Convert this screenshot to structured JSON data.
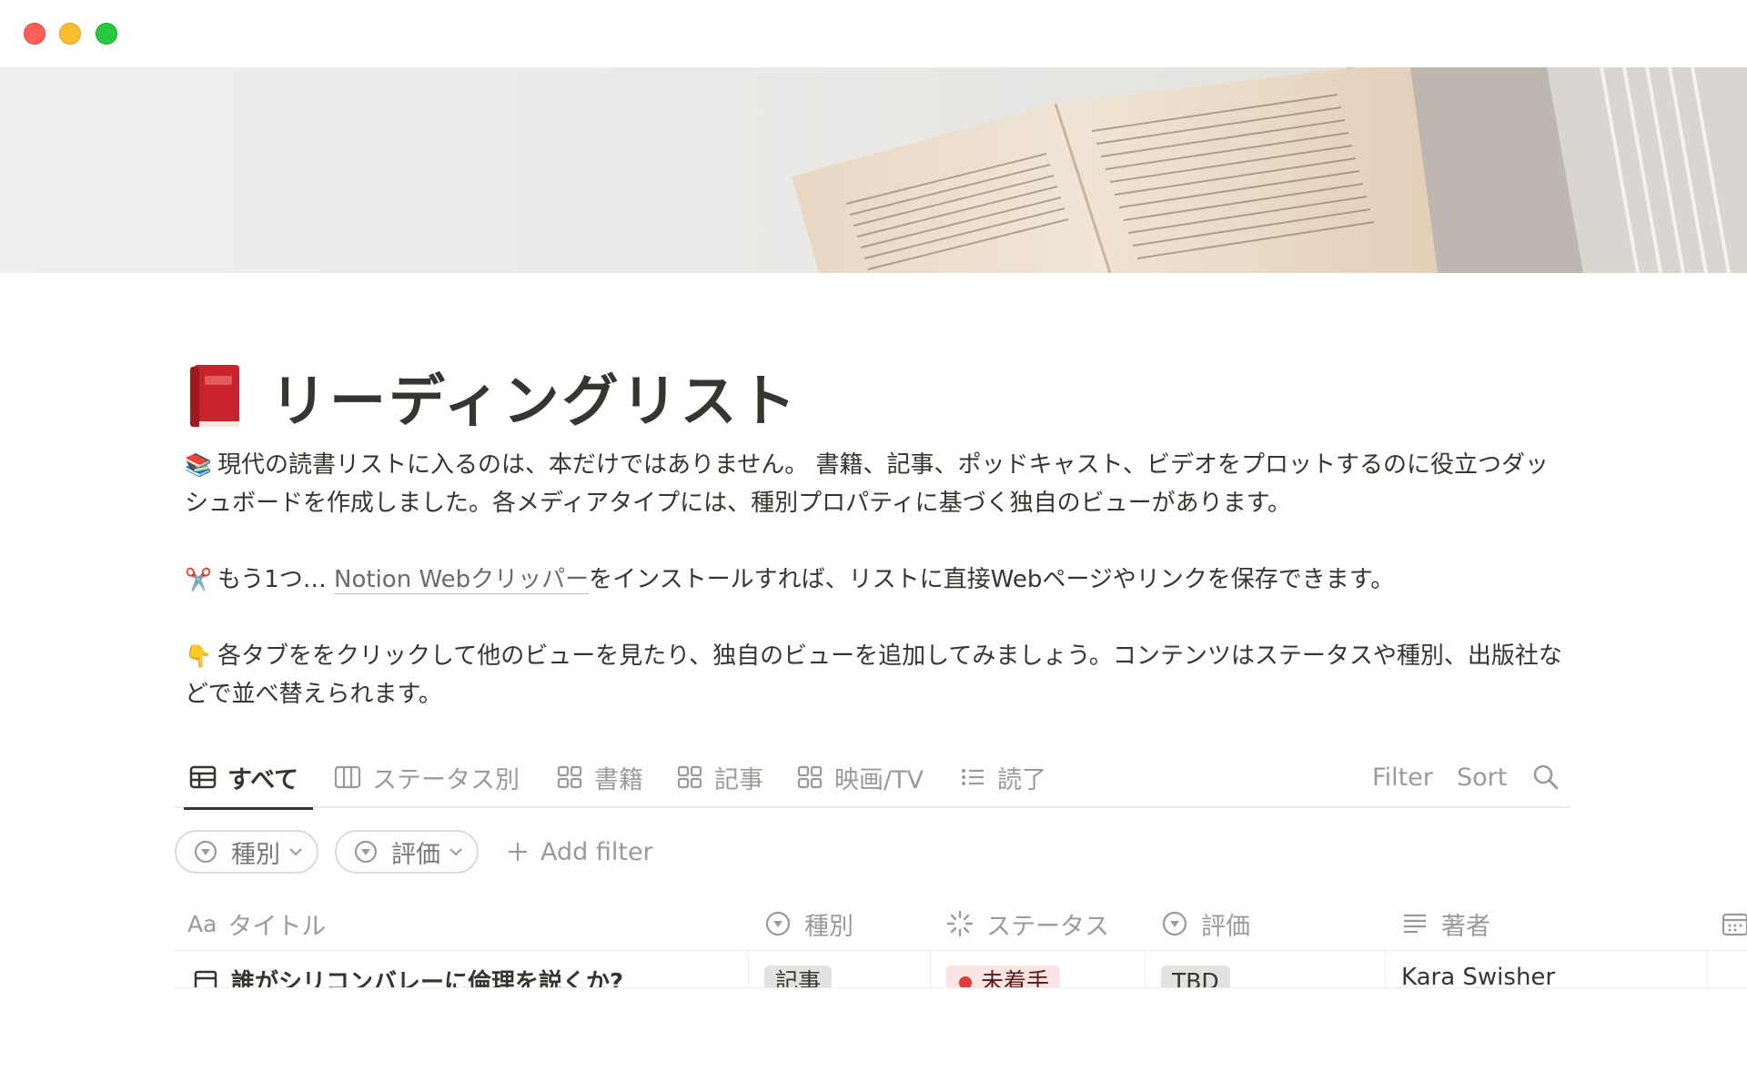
{
  "window": {
    "controls": [
      "close",
      "minimize",
      "zoom"
    ]
  },
  "cover": {
    "description_icon": "open-book-cover-image"
  },
  "page": {
    "icon": "red-book-icon",
    "title": "リーディングリスト",
    "paragraphs": [
      {
        "emoji": "📚",
        "text": "現代の読書リストに入るのは、本だけではありません。 書籍、記事、ポッドキャスト、ビデオをプロットするのに役立つダッシュボードを作成しました。各メディアタイプには、種別プロパティに基づく独自のビューがあります。"
      },
      {
        "emoji": "✂️",
        "prefix": "もう1つ… ",
        "link": "Notion Webクリッパー",
        "suffix": "をインストールすれば、リストに直接Webページやリンクを保存できます。"
      },
      {
        "emoji": "👇",
        "text": "各タブををクリックして他のビューを見たり、独自のビューを追加してみましょう。コンテンツはステータスや種別、出版社などで並べ替えられます。"
      }
    ]
  },
  "tabs": [
    {
      "label": "すべて",
      "icon": "table-icon",
      "active": true
    },
    {
      "label": "ステータス別",
      "icon": "board-icon",
      "active": false
    },
    {
      "label": "書籍",
      "icon": "gallery-icon",
      "active": false
    },
    {
      "label": "記事",
      "icon": "gallery-icon",
      "active": false
    },
    {
      "label": "映画/TV",
      "icon": "gallery-icon",
      "active": false
    },
    {
      "label": "読了",
      "icon": "list-icon",
      "active": false
    }
  ],
  "toolbar": {
    "filter_label": "Filter",
    "sort_label": "Sort",
    "search_icon": "search-icon"
  },
  "filters": [
    {
      "label": "種別",
      "icon": "select-property-icon"
    },
    {
      "label": "評価",
      "icon": "select-property-icon"
    }
  ],
  "add_filter_label": "Add filter",
  "table": {
    "columns": [
      {
        "label": "タイトル",
        "icon": "Aa"
      },
      {
        "label": "種別",
        "icon": "select-property-icon"
      },
      {
        "label": "ステータス",
        "icon": "status-property-icon"
      },
      {
        "label": "評価",
        "icon": "select-property-icon"
      },
      {
        "label": "著者",
        "icon": "text-property-icon"
      }
    ],
    "rows": [
      {
        "title": "誰がシリコンバレーに倫理を説くか?",
        "type": "記事",
        "status": "未着手",
        "rating": "TBD",
        "author": "Kara Swisher"
      }
    ]
  },
  "colors": {
    "text": "#37352f",
    "muted": "#9b9a97",
    "tag_gray": "#e3e2e0",
    "status_red_bg": "#fbe4e4",
    "status_red_dot": "#e03e3e"
  }
}
